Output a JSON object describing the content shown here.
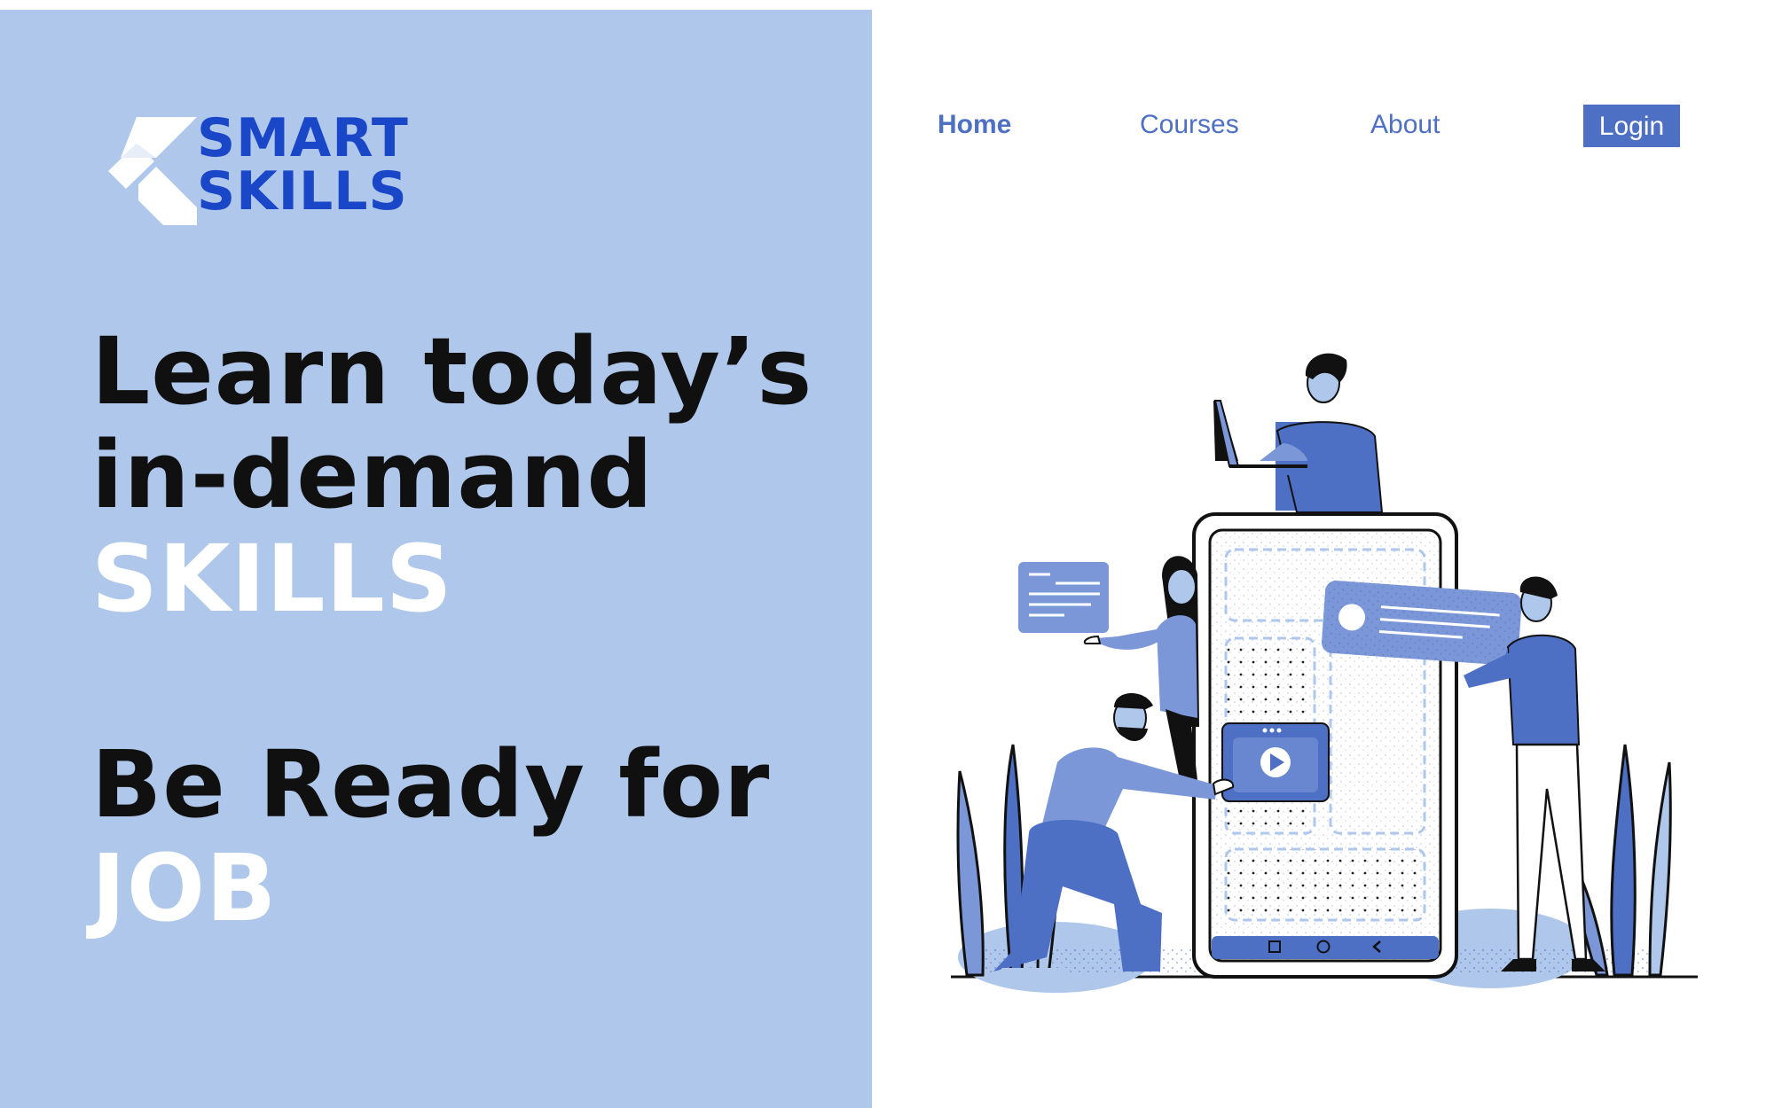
{
  "brand": {
    "line1": "SMART",
    "line2": "SKILLS",
    "color": "#1a47c7"
  },
  "nav": {
    "home": "Home",
    "courses": "Courses",
    "about": "About",
    "login": "Login"
  },
  "hero": {
    "line1": "Learn today’s",
    "line2": "in-demand",
    "line3": "SKILLS",
    "line4": "Be Ready for",
    "line5": "JOB"
  },
  "illustration": {
    "name": "people-building-mobile-app-illustration",
    "video_icon": "play-icon",
    "nav_icons": [
      "square-icon",
      "circle-icon",
      "back-chevron-icon"
    ]
  },
  "colors": {
    "panel": "#aec7ea",
    "accent": "#4d6fc4",
    "accent_dark": "#3e5fb8",
    "accent_light": "#7b97d8",
    "text_dark": "#101010",
    "white": "#ffffff"
  }
}
